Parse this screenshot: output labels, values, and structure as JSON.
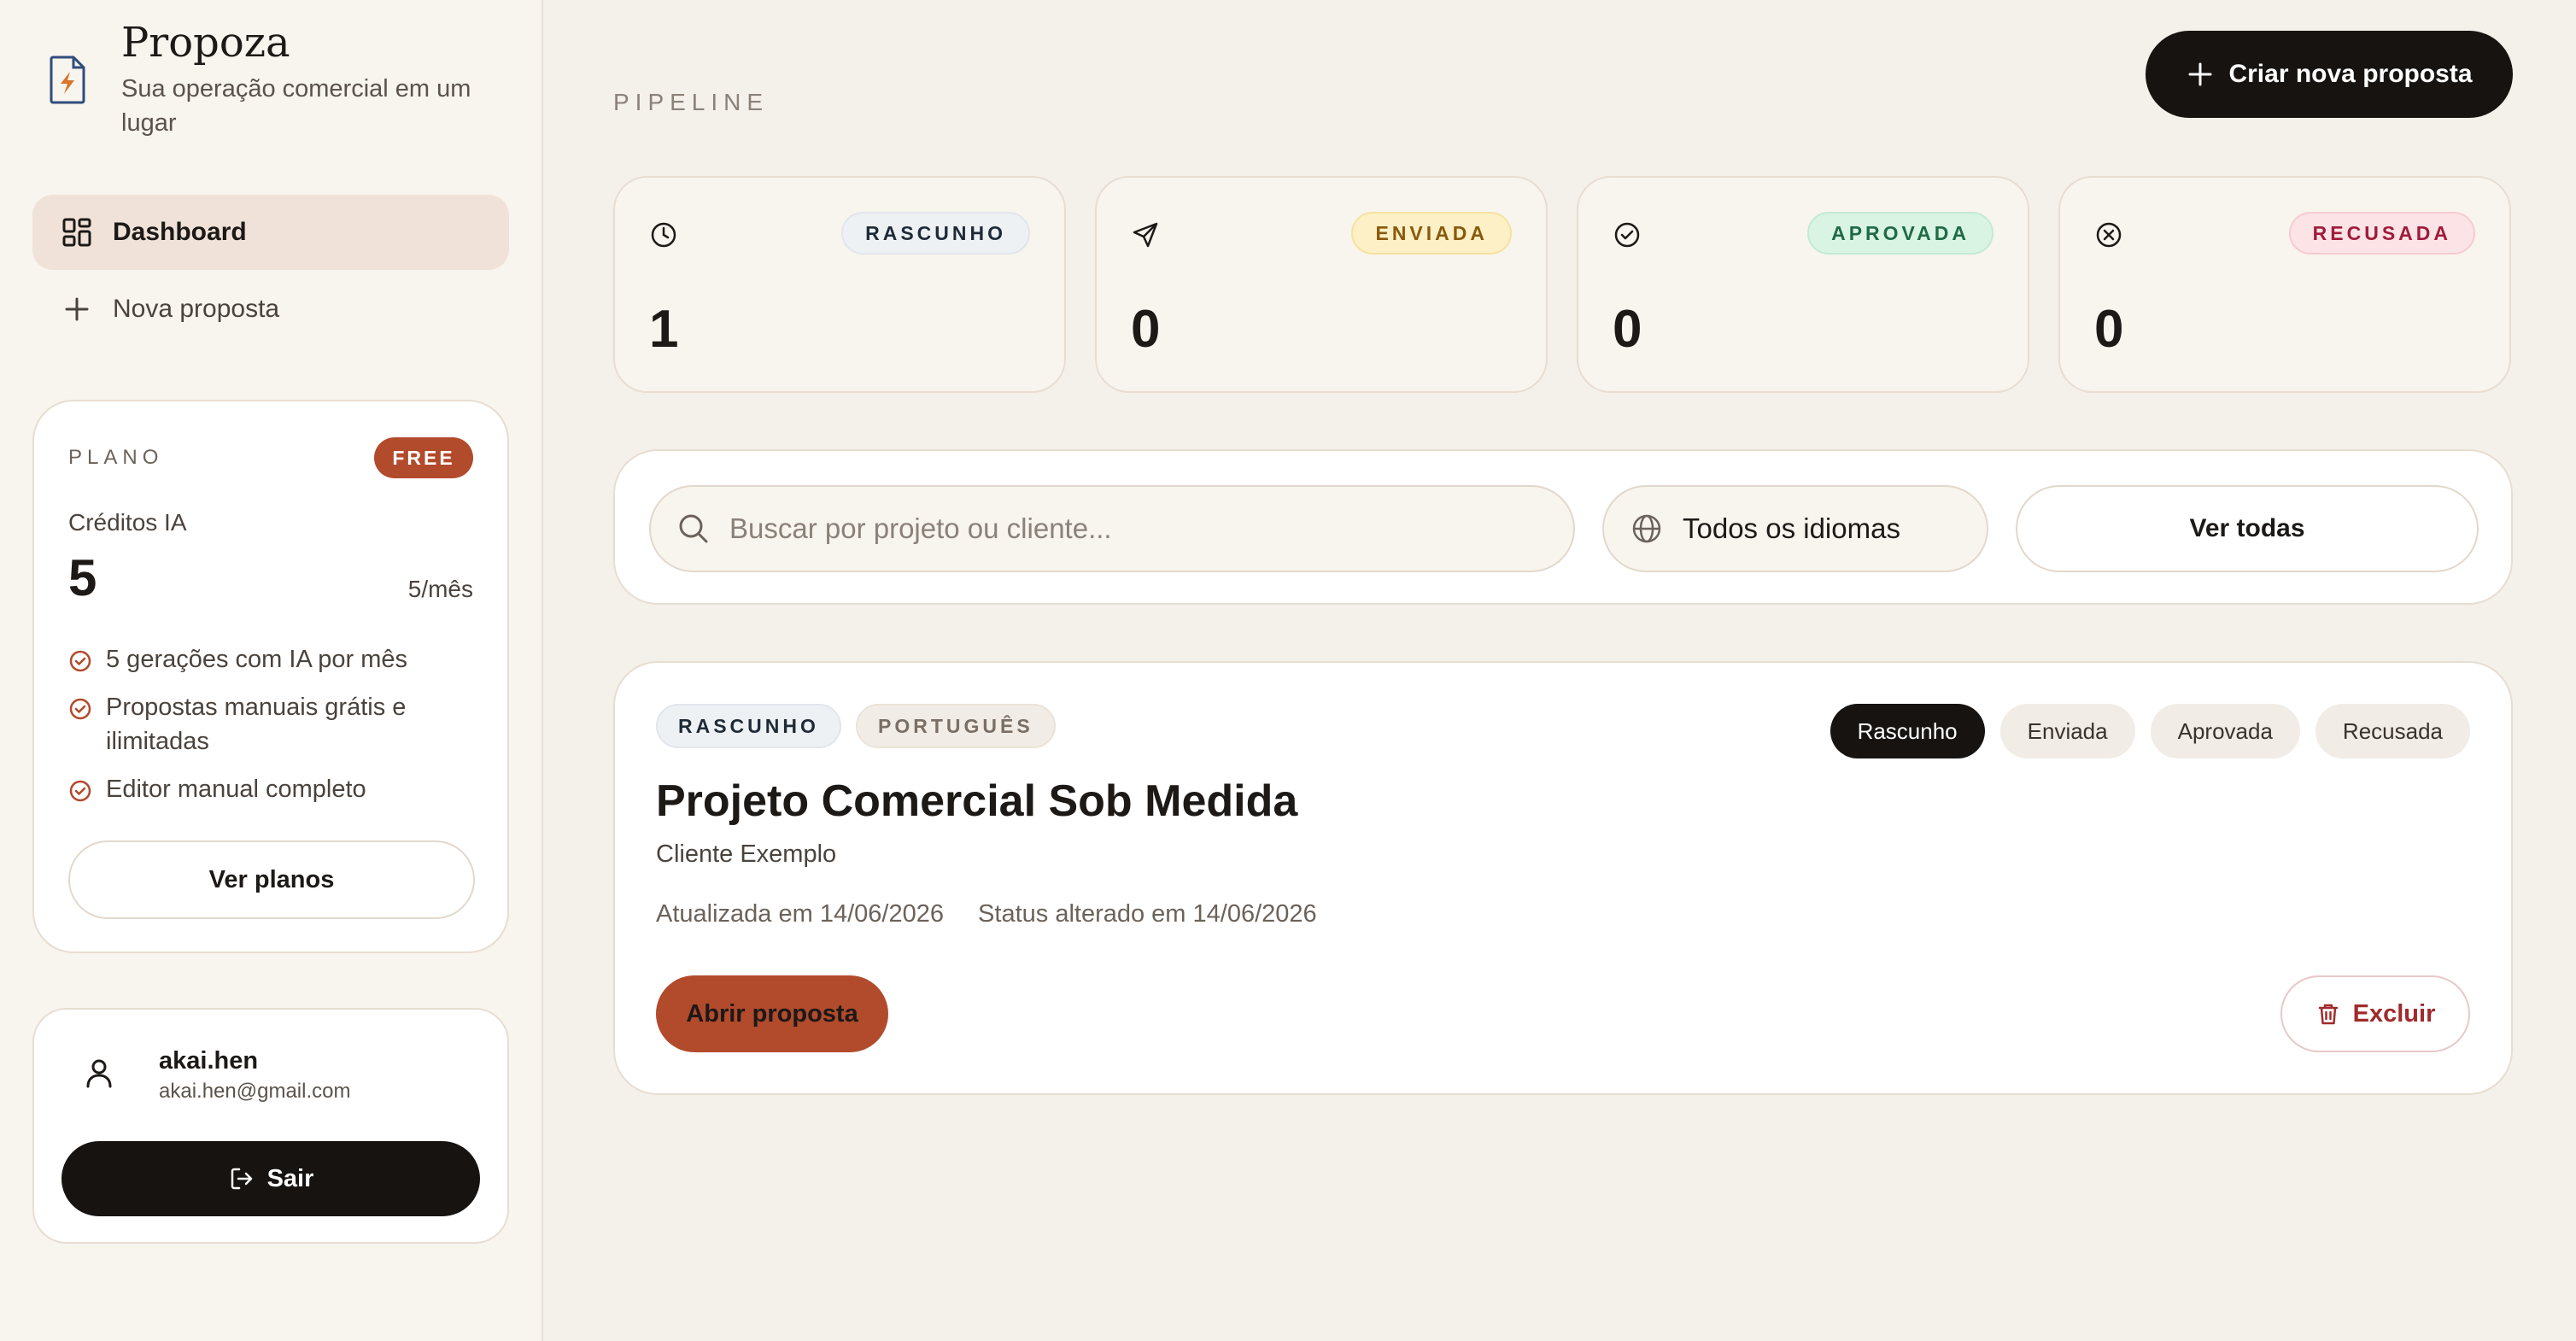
{
  "brand": {
    "name": "Propoza",
    "tagline": "Sua operação comercial em um lugar"
  },
  "nav": [
    {
      "label": "Dashboard",
      "icon": "grid-icon",
      "active": true
    },
    {
      "label": "Nova proposta",
      "icon": "plus-icon",
      "active": false
    }
  ],
  "plan": {
    "label": "PLANO",
    "badge": "FREE",
    "credits_label": "Créditos IA",
    "credits_value": "5",
    "credits_rate": "5/mês",
    "features": [
      "5 gerações com IA por mês",
      "Propostas manuais grátis e ilimitadas",
      "Editor manual completo"
    ],
    "button": "Ver planos"
  },
  "user": {
    "name": "akai.hen",
    "email": "akai.hen@gmail.com",
    "logout": "Sair"
  },
  "header": {
    "section": "PIPELINE",
    "create_button": "Criar nova proposta"
  },
  "stats": [
    {
      "label": "RASCUNHO",
      "value": "1",
      "icon": "clock-icon"
    },
    {
      "label": "ENVIADA",
      "value": "0",
      "icon": "send-icon"
    },
    {
      "label": "APROVADA",
      "value": "0",
      "icon": "check-circle-icon"
    },
    {
      "label": "RECUSADA",
      "value": "0",
      "icon": "x-circle-icon"
    }
  ],
  "filters": {
    "search_placeholder": "Buscar por projeto ou cliente...",
    "language": "Todos os idiomas",
    "view_all": "Ver todas"
  },
  "proposal": {
    "status_tag": "RASCUNHO",
    "language_tag": "PORTUGUÊS",
    "title": "Projeto Comercial Sob Medida",
    "client": "Cliente Exemplo",
    "updated": "Atualizada em 14/06/2026",
    "status_changed": "Status alterado em 14/06/2026",
    "status_options": [
      "Rascunho",
      "Enviada",
      "Aprovada",
      "Recusada"
    ],
    "open_button": "Abrir proposta",
    "delete_button": "Excluir"
  },
  "colors": {
    "accent": "#b24a2c",
    "dark": "#161311",
    "background": "#f4f0ea"
  }
}
